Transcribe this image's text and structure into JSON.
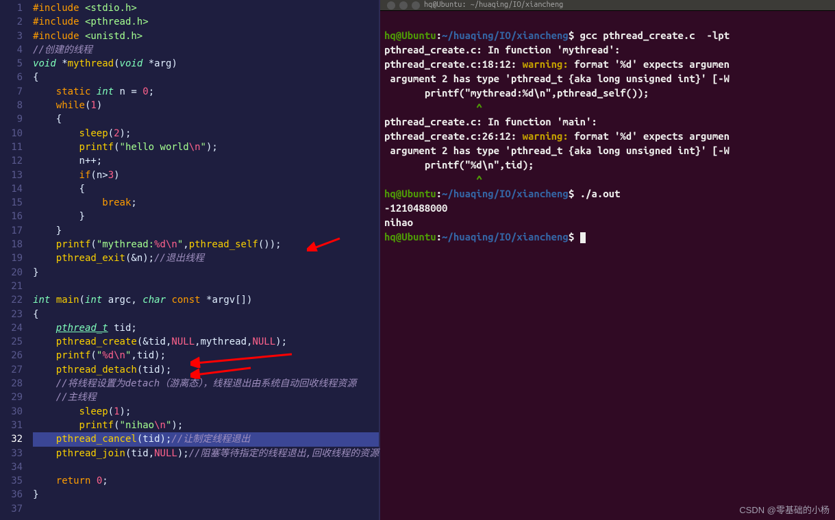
{
  "editor": {
    "lines": [
      {
        "n": 1,
        "html": "<span class='preproc'>#include</span> <span class='incfile'>&lt;stdio.h&gt;</span>"
      },
      {
        "n": 2,
        "html": "<span class='preproc'>#include</span> <span class='incfile'>&lt;pthread.h&gt;</span>"
      },
      {
        "n": 3,
        "html": "<span class='preproc'>#include</span> <span class='incfile'>&lt;unistd.h&gt;</span>"
      },
      {
        "n": 4,
        "html": "<span class='comment'>//创建的线程</span>"
      },
      {
        "n": 5,
        "html": "<span class='type'>void</span> <span class='punct'>*</span><span class='fn'>mythread</span><span class='punct'>(</span><span class='type'>void</span> <span class='punct'>*</span><span class='param'>arg</span><span class='punct'>)</span>"
      },
      {
        "n": 6,
        "html": "<span class='punct'>{</span>"
      },
      {
        "n": 7,
        "html": "    <span class='kw'>static</span> <span class='type'>int</span> <span class='param'>n</span> <span class='punct'>=</span> <span class='num'>0</span><span class='punct'>;</span>"
      },
      {
        "n": 8,
        "html": "    <span class='kw'>while</span><span class='punct'>(</span><span class='num'>1</span><span class='punct'>)</span>"
      },
      {
        "n": 9,
        "html": "    <span class='punct'>{</span>"
      },
      {
        "n": 10,
        "html": "        <span class='fn'>sleep</span><span class='punct'>(</span><span class='num'>2</span><span class='punct'>);</span>"
      },
      {
        "n": 11,
        "html": "        <span class='fn'>printf</span><span class='punct'>(</span><span class='str'>\"hello world</span><span class='const'>\\n</span><span class='str'>\"</span><span class='punct'>);</span>"
      },
      {
        "n": 12,
        "html": "        <span class='param'>n</span><span class='punct'>++;</span>"
      },
      {
        "n": 13,
        "html": "        <span class='kw'>if</span><span class='punct'>(</span><span class='param'>n</span><span class='punct'>&gt;</span><span class='num'>3</span><span class='punct'>)</span>"
      },
      {
        "n": 14,
        "html": "        <span class='punct'>{</span>"
      },
      {
        "n": 15,
        "html": "            <span class='kw'>break</span><span class='punct'>;</span>"
      },
      {
        "n": 16,
        "html": "        <span class='punct'>}</span>"
      },
      {
        "n": 17,
        "html": "    <span class='punct'>}</span>"
      },
      {
        "n": 18,
        "html": "    <span class='fn'>printf</span><span class='punct'>(</span><span class='str'>\"mythread:</span><span class='const'>%d\\n</span><span class='str'>\"</span><span class='punct'>,</span><span class='fn'>pthread_self</span><span class='punct'>());</span>"
      },
      {
        "n": 19,
        "html": "    <span class='fn'>pthread_exit</span><span class='punct'>(&amp;</span><span class='param'>n</span><span class='punct'>);</span><span class='comment'>//退出线程</span>"
      },
      {
        "n": 20,
        "html": "<span class='punct'>}</span>"
      },
      {
        "n": 21,
        "html": ""
      },
      {
        "n": 22,
        "html": "<span class='type'>int</span> <span class='fn'>main</span><span class='punct'>(</span><span class='type'>int</span> <span class='param'>argc</span><span class='punct'>,</span> <span class='type'>char</span> <span class='kw'>const</span> <span class='punct'>*</span><span class='param'>argv</span><span class='punct'>[])</span>"
      },
      {
        "n": 23,
        "html": "<span class='punct'>{</span>"
      },
      {
        "n": 24,
        "html": "    <span class='type underline'>pthread_t</span> <span class='param'>tid</span><span class='punct'>;</span>"
      },
      {
        "n": 25,
        "html": "    <span class='fn'>pthread_create</span><span class='punct'>(&amp;</span><span class='param'>tid</span><span class='punct'>,</span><span class='const'>NULL</span><span class='punct'>,</span><span class='param'>mythread</span><span class='punct'>,</span><span class='const'>NULL</span><span class='punct'>);</span>"
      },
      {
        "n": 26,
        "html": "    <span class='fn'>printf</span><span class='punct'>(</span><span class='str'>\"</span><span class='const'>%d\\n</span><span class='str'>\"</span><span class='punct'>,</span><span class='param'>tid</span><span class='punct'>);</span>"
      },
      {
        "n": 27,
        "html": "    <span class='fn'>pthread_detach</span><span class='punct'>(</span><span class='param'>tid</span><span class='punct'>);</span>"
      },
      {
        "n": 28,
        "html": "    <span class='comment'>//将线程设置为detach（游离态），线程退出由系统自动回收线程资源</span>"
      },
      {
        "n": 29,
        "html": "    <span class='comment'>//主线程</span>"
      },
      {
        "n": 30,
        "html": "        <span class='fn'>sleep</span><span class='punct'>(</span><span class='num'>1</span><span class='punct'>);</span>"
      },
      {
        "n": 31,
        "html": "        <span class='fn'>printf</span><span class='punct'>(</span><span class='str'>\"nihao</span><span class='const'>\\n</span><span class='str'>\"</span><span class='punct'>);</span>"
      },
      {
        "n": 32,
        "html": "    <span class='fn'>pthread_cancel</span><span class='punct'>(</span><span class='param'>tid</span><span class='punct'>);</span><span class='comment'>//让制定线程退出</span>",
        "highlight": true
      },
      {
        "n": 33,
        "html": "    <span class='fn'>pthread_join</span><span class='punct'>(</span><span class='param'>tid</span><span class='punct'>,</span><span class='const'>NULL</span><span class='punct'>);</span><span class='comment'>//阻塞等待指定的线程退出,回收线程的资源</span>"
      },
      {
        "n": 34,
        "html": ""
      },
      {
        "n": 35,
        "html": "    <span class='kw'>return</span> <span class='num'>0</span><span class='punct'>;</span>"
      },
      {
        "n": 36,
        "html": "<span class='punct'>}</span>"
      },
      {
        "n": 37,
        "html": ""
      }
    ]
  },
  "terminal": {
    "title": "hq@Ubuntu: ~/huaqing/IO/xiancheng",
    "prompt_user": "hq@Ubuntu",
    "prompt_path": "~/huaqing/IO/xiancheng",
    "cmd1": "gcc pthread_create.c  -lpt",
    "line2a": "pthread_create.c:",
    "line2b": " In function '",
    "line2c": "mythread",
    "line2d": "':",
    "line3a": "pthread_create.c:18:12:",
    "warning": "warning:",
    "line3b": " format '",
    "line3c": "%d",
    "line3d": "' expects argumen",
    "line4a": " argument 2 has type '",
    "line4b": "pthread_t {aka long unsigned int}",
    "line4c": "' [-W",
    "line5": "       printf(\"mythread:%d\\n\",pthread_self());",
    "caret1": "                ^",
    "line7a": "pthread_create.c:",
    "line7b": " In function '",
    "line7c": "main",
    "line7d": "':",
    "line8a": "pthread_create.c:26:12:",
    "line10": "       printf(\"%d\\n\",tid);",
    "caret2": "                ^",
    "cmd2": "./a.out",
    "out1": "-1210488000",
    "out2": "nihao"
  },
  "watermark": "CSDN @零基础的小杨"
}
